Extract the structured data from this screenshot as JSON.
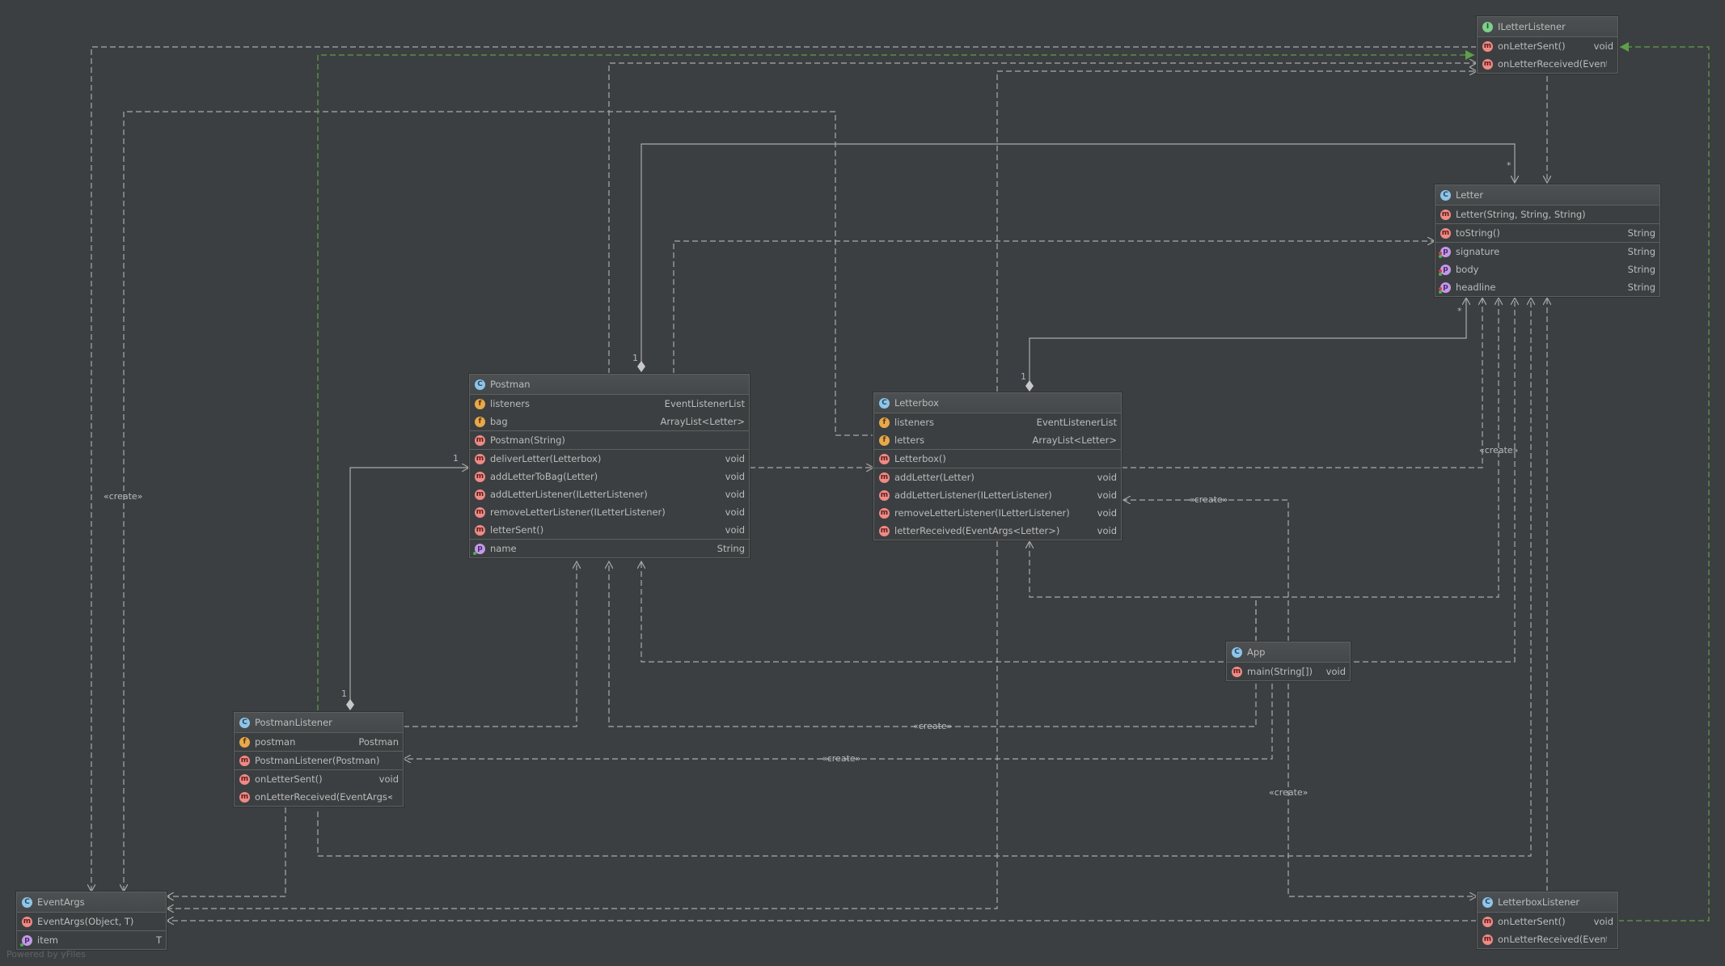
{
  "diagram": {
    "footer": "Powered by yFiles",
    "stereotype_create": "«create»",
    "multiplicities": {
      "one": "1",
      "many": "*"
    }
  },
  "classes": {
    "ILetterListener": {
      "kind_icon": "I",
      "name": "ILetterListener",
      "methods": [
        {
          "name": "onLetterSent()",
          "type": "void"
        },
        {
          "name": "onLetterReceived(EventArgs",
          "type": ""
        }
      ]
    },
    "Letter": {
      "kind_icon": "C",
      "name": "Letter",
      "constructors": [
        {
          "name": "Letter(String, String, String)"
        }
      ],
      "methods": [
        {
          "name": "toString()",
          "type": "String"
        }
      ],
      "properties": [
        {
          "name": "signature",
          "type": "String"
        },
        {
          "name": "body",
          "type": "String"
        },
        {
          "name": "headline",
          "type": "String"
        }
      ]
    },
    "Postman": {
      "kind_icon": "C",
      "name": "Postman",
      "fields": [
        {
          "name": "listeners",
          "type": "EventListenerList"
        },
        {
          "name": "bag",
          "type": "ArrayList<Letter>"
        }
      ],
      "constructors": [
        {
          "name": "Postman(String)"
        }
      ],
      "methods": [
        {
          "name": "deliverLetter(Letterbox)",
          "type": "void"
        },
        {
          "name": "addLetterToBag(Letter)",
          "type": "void"
        },
        {
          "name": "addLetterListener(ILetterListener)",
          "type": "void"
        },
        {
          "name": "removeLetterListener(ILetterListener)",
          "type": "void"
        },
        {
          "name": "letterSent()",
          "type": "void"
        }
      ],
      "properties": [
        {
          "name": "name",
          "type": "String"
        }
      ]
    },
    "Letterbox": {
      "kind_icon": "C",
      "name": "Letterbox",
      "fields": [
        {
          "name": "listeners",
          "type": "EventListenerList"
        },
        {
          "name": "letters",
          "type": "ArrayList<Letter>"
        }
      ],
      "constructors": [
        {
          "name": "Letterbox()"
        }
      ],
      "methods": [
        {
          "name": "addLetter(Letter)",
          "type": "void"
        },
        {
          "name": "addLetterListener(ILetterListener)",
          "type": "void"
        },
        {
          "name": "removeLetterListener(ILetterListener)",
          "type": "void"
        },
        {
          "name": "letterReceived(EventArgs<Letter>)",
          "type": "void"
        }
      ]
    },
    "App": {
      "kind_icon": "C",
      "name": "App",
      "methods": [
        {
          "name": "main(String[])",
          "type": "void"
        }
      ]
    },
    "PostmanListener": {
      "kind_icon": "C",
      "name": "PostmanListener",
      "fields": [
        {
          "name": "postman",
          "type": "Postman"
        }
      ],
      "constructors": [
        {
          "name": "PostmanListener(Postman)"
        }
      ],
      "methods": [
        {
          "name": "onLetterSent()",
          "type": "void"
        },
        {
          "name": "onLetterReceived(EventArgs<Letter",
          "type": ""
        }
      ]
    },
    "EventArgs": {
      "kind_icon": "C",
      "name": "EventArgs",
      "constructors": [
        {
          "name": "EventArgs(Object, T)"
        }
      ],
      "properties": [
        {
          "name": "item",
          "type": "T"
        }
      ]
    },
    "LetterboxListener": {
      "kind_icon": "C",
      "name": "LetterboxListener",
      "methods": [
        {
          "name": "onLetterSent()",
          "type": "void"
        },
        {
          "name": "onLetterReceived(EventArgs",
          "type": ""
        }
      ]
    }
  },
  "colors": {
    "background": "#3c3f41",
    "edge": "#a9a9a9",
    "realization": "#5f9e4a",
    "class_icon": "#8fc5e8",
    "interface_icon": "#7ed08a",
    "field_icon": "#e8a94b",
    "method_icon": "#ef8a85",
    "property_icon": "#c39ae6"
  }
}
